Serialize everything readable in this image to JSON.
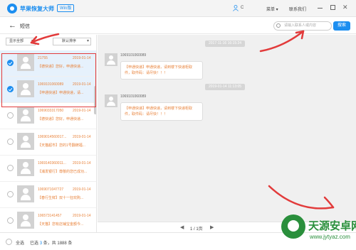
{
  "app": {
    "name": "苹果恢复大师",
    "tag": "Win版"
  },
  "titlebar": {
    "user_text": "C",
    "menu_label": "菜单 ▾",
    "contact_label": "联系我们",
    "close_glyph": "✕"
  },
  "toolbar": {
    "back_glyph": "←",
    "title": "短信",
    "search_placeholder": "请输入联系人或内容",
    "search_button": "搜索"
  },
  "filters": {
    "show": "显示全部",
    "sort": "默认排序"
  },
  "messages": [
    {
      "sender": "21755",
      "date": "2019-01-14",
      "snippet": "【德快递】您好，申通快递...",
      "checked": true
    },
    {
      "sender": "1069101060089",
      "date": "2019-01-14",
      "snippet": "【申通快递】申通快递，请...",
      "checked": true
    },
    {
      "sender": "1069033317050",
      "date": "2019-01-14",
      "snippet": "【德快递】您好，申通快递...",
      "checked": false
    },
    {
      "sender": "1069014560017...",
      "date": "2019-01-14",
      "snippet": "【天猫超市】您的1号翻牌福...",
      "checked": false
    },
    {
      "sender": "1069140360011...",
      "date": "2019-01-14",
      "snippet": "【浦发银行】尊敬的您已成功...",
      "checked": false
    },
    {
      "sender": "1069071047727",
      "date": "2019-01-14",
      "snippet": "【春行生鲜】双十一狂欢购...",
      "checked": false
    },
    {
      "sender": "106573141457",
      "date": "2019-01-14",
      "snippet": "【天猫】您有店铺宝金额今...",
      "checked": false
    }
  ],
  "conversation": {
    "entries": [
      {
        "time": "2017-11-16 16:15:24",
        "from": "1069101060089",
        "text": "【申通快递】申通快递，请到楼下快递柜取件，取件码：请尽快！！！"
      },
      {
        "time": "2019-01-14 11:13:05",
        "from": "1069101060089",
        "text": "【申通快递】申通快递，请到楼下快递柜取件，取件码：请尽快！！！"
      }
    ]
  },
  "pager": {
    "prev": "◀",
    "label": "1 / 1页",
    "next": "▶"
  },
  "footer": {
    "select_all": "全选",
    "selected_prefix": "已选",
    "selected_count": "3",
    "selected_suffix": "条，共 1888 条"
  },
  "watermark": {
    "title": "天源安卓网",
    "url": "www.jytyaz.com"
  },
  "colors": {
    "accent": "#1c8ef0",
    "highlight_text": "#e8823a",
    "annotation": "#e23b3b",
    "watermark": "#2a8f3c"
  }
}
